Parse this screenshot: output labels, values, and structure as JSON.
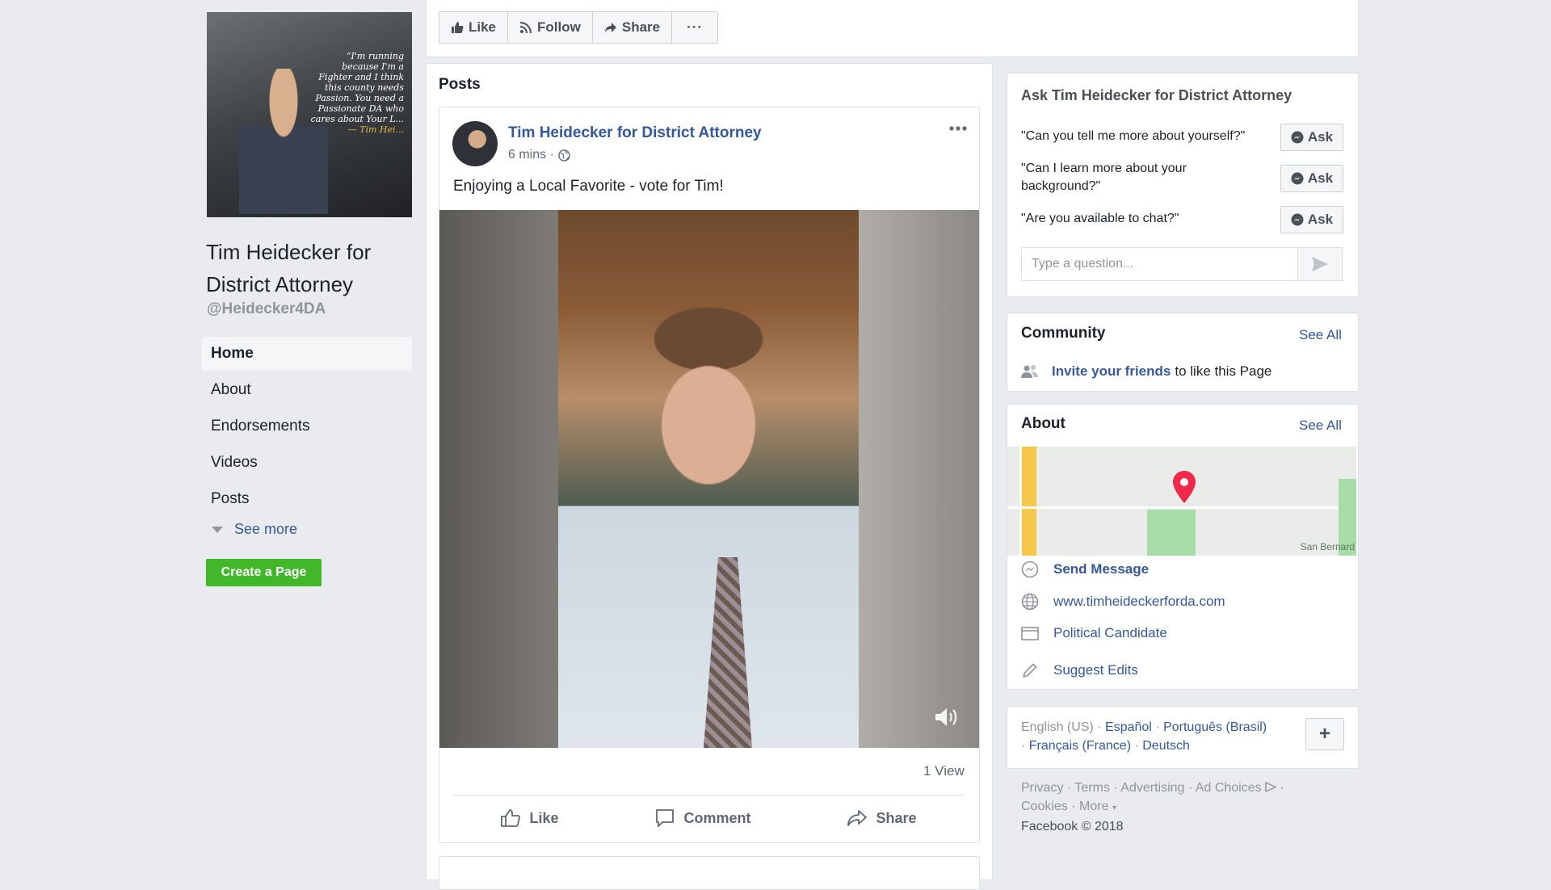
{
  "page": {
    "name": "Tim Heidecker for District Attorney",
    "handle": "@Heidecker4DA",
    "profile_quote": "“I'm running because I'm a Fighter and I think this county needs Passion. You need a Passionate DA who cares about Your L...",
    "profile_quote_signature": "— Tim Hei..."
  },
  "nav": {
    "items": [
      {
        "label": "Home",
        "active": true
      },
      {
        "label": "About"
      },
      {
        "label": "Endorsements"
      },
      {
        "label": "Videos"
      },
      {
        "label": "Posts"
      }
    ],
    "see_more": "See more",
    "create_page": "Create a Page"
  },
  "actions": {
    "like": "Like",
    "follow": "Follow",
    "share": "Share",
    "more": "···"
  },
  "feed": {
    "title": "Posts",
    "post": {
      "author": "Tim Heidecker for District Attorney",
      "time": "6 mins ·",
      "text": "Enjoying a Local Favorite - vote for Tim!",
      "views": "1 View",
      "like": "Like",
      "comment": "Comment",
      "share": "Share"
    }
  },
  "ask": {
    "title": "Ask Tim Heidecker for District Attorney",
    "questions": [
      {
        "text": "\"Can you tell me more about yourself?\"",
        "button": "Ask"
      },
      {
        "text": "\"Can I learn more about your background?\"",
        "button": "Ask"
      },
      {
        "text": "\"Are you available to chat?\"",
        "button": "Ask"
      }
    ],
    "placeholder": "Type a question..."
  },
  "community": {
    "title": "Community",
    "see_all": "See All",
    "invite_link": "Invite your friends",
    "invite_rest": "to like this Page"
  },
  "about": {
    "title": "About",
    "see_all": "See All",
    "map_label": "San Bernard",
    "send_message": "Send Message",
    "website": "www.timheideckerforda.com",
    "category": "Political Candidate",
    "suggest": "Suggest Edits"
  },
  "languages": {
    "current": "English (US) ·",
    "es": "Español",
    "pt": "Português (Brasil)",
    "fr": "Français (France)",
    "de": "Deutsch",
    "plus": "+"
  },
  "footer": {
    "privacy": "Privacy",
    "terms": "Terms",
    "advertising": "Advertising",
    "ad_choices": "Ad Choices",
    "cookies": "Cookies",
    "more": "More",
    "copyright": "Facebook © 2018"
  },
  "colors": {
    "link": "#365899",
    "create_page_green": "#42b72a",
    "page_bg": "#e9ebee"
  }
}
